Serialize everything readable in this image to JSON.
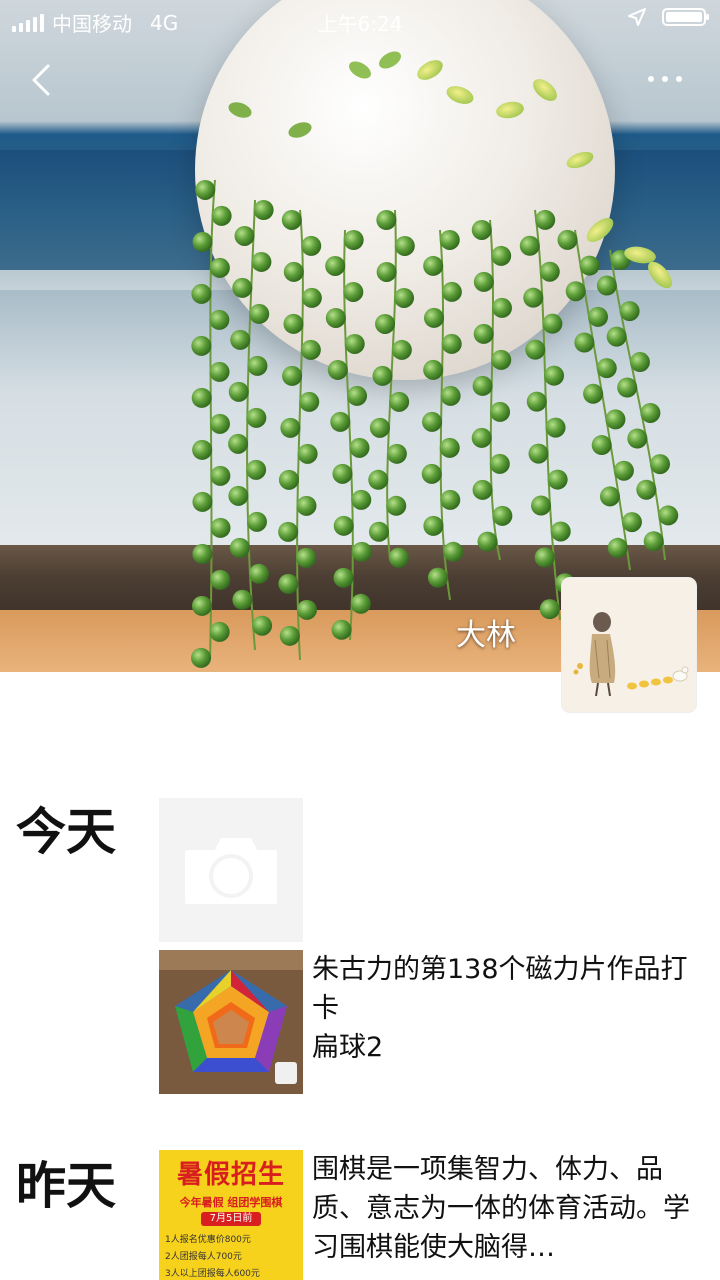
{
  "status_bar": {
    "carrier": "中国移动",
    "network": "4G",
    "time": "上午6:24"
  },
  "header": {
    "back_icon": "chevron-left-icon",
    "more_icon": "more-dots-icon"
  },
  "profile": {
    "username": "大林"
  },
  "feed": {
    "days": [
      {
        "label": "今天",
        "camera_icon": "camera-icon",
        "posts": [
          {
            "text_line1": "朱古力的第138个磁力片作品打卡",
            "text_line2": "扁球2"
          }
        ]
      },
      {
        "label": "昨天",
        "posts": [
          {
            "text": "围棋是一项集智力、体力、品质、意志为一体的体育活动。学习围棋能使大脑得…",
            "thumb_title": "暑假招生",
            "thumb_subtitle": "今年暑假 组团学围棋",
            "thumb_date": "7月5日前",
            "thumb_lines": [
              "1人报名优惠价800元",
              "2人团报每人700元",
              "3人以上团报每人600元"
            ]
          }
        ]
      }
    ]
  },
  "colors": {
    "background": "#ffffff",
    "text": "#111111",
    "camera_tile": "#f3f3f3"
  }
}
